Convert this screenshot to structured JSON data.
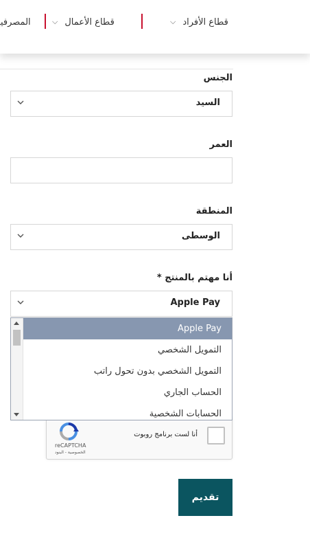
{
  "nav": {
    "items": [
      {
        "label": "قطاع الأفراد"
      },
      {
        "label": "قطاع الأعمال"
      },
      {
        "label": "المصرفية"
      }
    ]
  },
  "form": {
    "gender": {
      "label": "الجنس",
      "value": "السيد"
    },
    "age": {
      "label": "العمر",
      "value": ""
    },
    "region": {
      "label": "المنطقة",
      "value": "الوسطى"
    },
    "product": {
      "label": "أنا مهتم بالمنتج *",
      "value": "Apple Pay",
      "options": [
        "Apple Pay",
        "التمويل الشخصي",
        "التمويل الشخصي بدون تحول راتب",
        "الحساب الجاري",
        "الحسابات الشخصية"
      ],
      "selected_index": 0
    }
  },
  "recaptcha": {
    "label": "أنا لست برنامج روبوت",
    "brand": "reCAPTCHA",
    "links": "الخصوصية - البنود"
  },
  "submit_label": "تقديم",
  "colors": {
    "accent": "#c8102e",
    "button": "#0b5560",
    "option_selected": "#8797b0"
  }
}
